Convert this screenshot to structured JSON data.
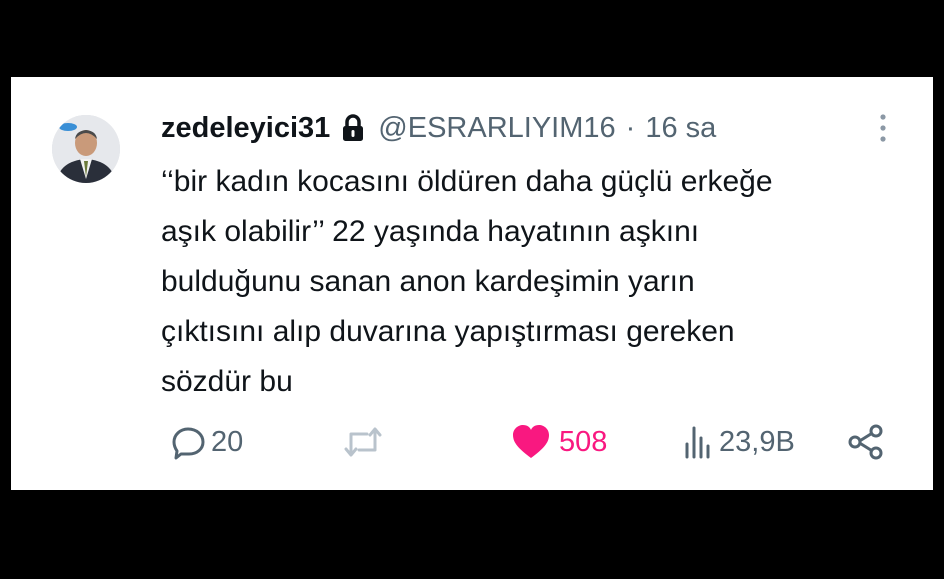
{
  "tweet": {
    "display_name": "zedeleyici31",
    "handle": "@ESRARLIYIM16",
    "separator": "·",
    "time": "16 sa",
    "text": "‘‘bir kadın kocasını öldüren daha güçlü erkeğe\naşık olabilir’’ 22 yaşında hayatının aşkını\nbulduğunu sanan anon kardeşimin yarın\nçıktısını alıp duvarına yapıştırması gereken\nsözdür bu",
    "protected_icon": "lock-icon",
    "more_icon": "vertical-dots-icon"
  },
  "actions": {
    "replies": "20",
    "retweets": "",
    "likes": "508",
    "views": "23,9B",
    "like_color": "#f91880",
    "muted_color": "#536471"
  }
}
